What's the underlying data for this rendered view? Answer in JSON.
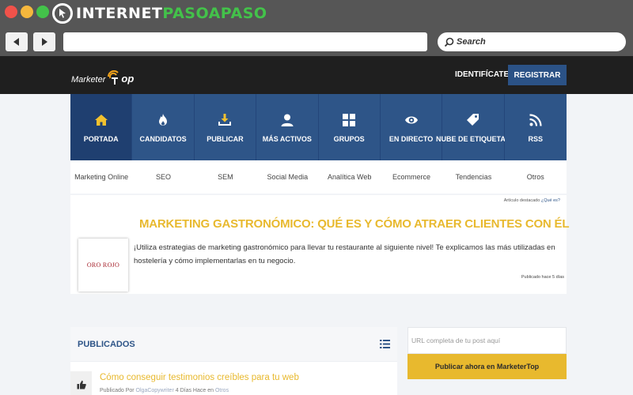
{
  "window": {
    "brand_prefix": "INTERNET",
    "brand_accent": "PASOAPASO"
  },
  "toolbar": {
    "search_placeholder": "Search"
  },
  "site": {
    "header": {
      "logo_text": "Marketer",
      "logo_suffix": "op",
      "login_label": "IDENTIFÍCATE",
      "register_label": "REGISTRAR"
    },
    "main_nav": [
      {
        "label": "PORTADA",
        "icon": "home-icon",
        "active": true
      },
      {
        "label": "CANDIDATOS",
        "icon": "flame-icon"
      },
      {
        "label": "PUBLICAR",
        "icon": "download-icon"
      },
      {
        "label": "MÁS ACTIVOS",
        "icon": "user-icon"
      },
      {
        "label": "GRUPOS",
        "icon": "grid-icon"
      },
      {
        "label": "EN DIRECTO",
        "icon": "eye-icon"
      },
      {
        "label": "NUBE DE ETIQUETAS",
        "icon": "tags-icon"
      },
      {
        "label": "RSS",
        "icon": "rss-icon"
      }
    ],
    "sub_nav": [
      "Marketing Online",
      "SEO",
      "SEM",
      "Social Media",
      "Analítica Web",
      "Ecommerce",
      "Tendencias",
      "Otros"
    ],
    "featured": {
      "tag_label": "Artículo destacado",
      "tag_question": "¿Qué es?",
      "title": "MARKETING GASTRONÓMICO: QUÉ ES Y CÓMO ATRAER CLIENTES CON ÉL",
      "thumb_text": "ORO ROJO",
      "excerpt": "¡Utiliza estrategias de marketing gastronómico para llevar tu restaurante al siguiente nivel! Te explicamos las más utilizadas en hostelería y cómo implementarlas en tu negocio.",
      "published": "Publicado hace 5 días"
    },
    "published": {
      "title": "PUBLICADOS",
      "posts": [
        {
          "title": "Cómo conseguir testimonios creíbles para tu web",
          "meta_prefix": "Publicado Por",
          "author": "OlgaCopywriter",
          "meta_time": "4 Días Hace en",
          "category": "Otros"
        }
      ]
    },
    "sidebar": {
      "url_placeholder": "URL completa de tu post aquí",
      "publish_label": "Publicar ahora en MarketerTop"
    }
  },
  "colors": {
    "nav_blue": "#2e5588",
    "nav_active": "#1f3f70",
    "accent_yellow": "#e8b92e",
    "header_dark": "#1f1f1f"
  }
}
